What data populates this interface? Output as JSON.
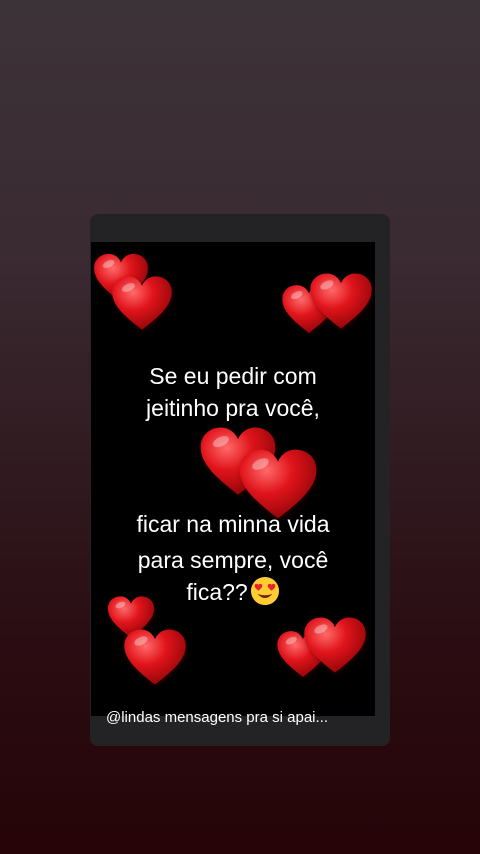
{
  "post": {
    "lines_top": [
      "Se  eu  pedir com",
      "jeitinho pra você,"
    ],
    "lines_bottom": [
      "ficar na minna vida",
      "para sempre, você"
    ],
    "last_line": "fica??",
    "emoji": "smiling-face-with-heart-eyes"
  },
  "watermark": {
    "text": "@lindas mensagens pra si apai..."
  },
  "colors": {
    "background_top": "#3c3338",
    "background_bottom": "#260408",
    "card": "#232326",
    "media": "#000000",
    "heart": "#e0141b",
    "text": "#ffffff"
  }
}
